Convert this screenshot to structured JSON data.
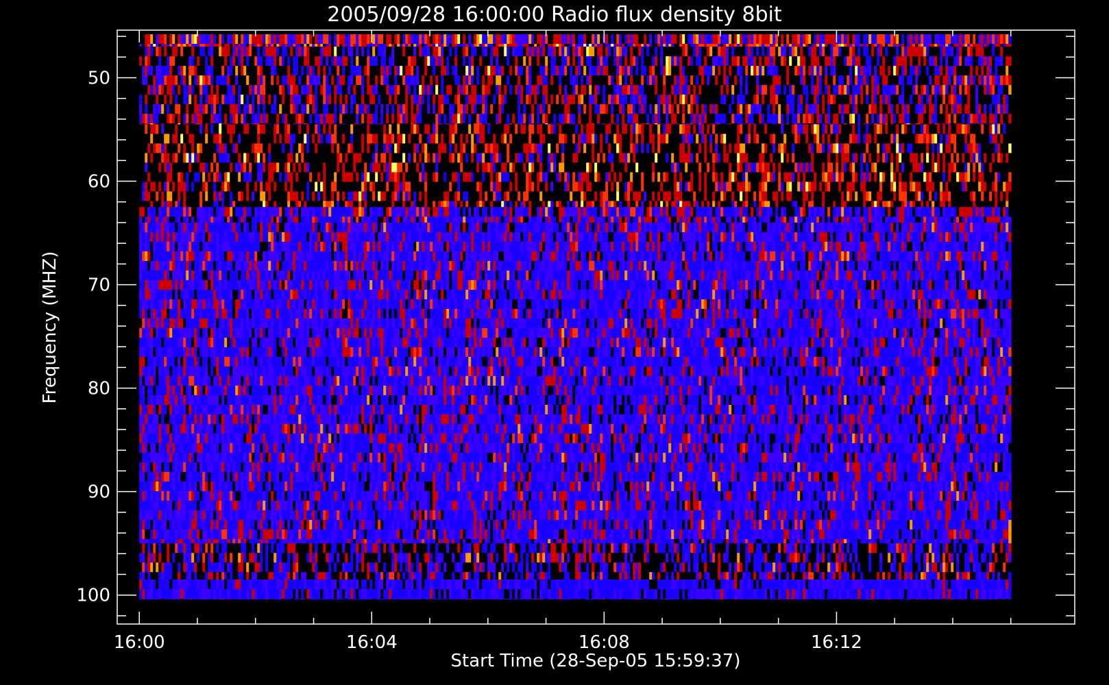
{
  "chart_data": {
    "type": "heatmap",
    "title": "2005/09/28 16:00:00 Radio flux density 8bit",
    "xlabel": "Start Time (28-Sep-05 15:59:37)",
    "ylabel": "Frequency (MHZ)",
    "x_tick_labels": [
      "16:00",
      "16:04",
      "16:08",
      "16:12"
    ],
    "x_ticks_minutes": [
      0,
      4,
      8,
      12
    ],
    "x_range_minutes": [
      -0.38,
      16.1
    ],
    "x_data_range_minutes": [
      0,
      15.0
    ],
    "y_tick_labels": [
      "50",
      "60",
      "70",
      "80",
      "90",
      "100"
    ],
    "y_ticks": [
      50,
      60,
      70,
      80,
      90,
      100
    ],
    "ylim": [
      45.4,
      102.8
    ],
    "y_data_range": [
      45.8,
      100.4
    ],
    "y_inverted": true,
    "colormap": [
      "#000000",
      "#1a00ff",
      "#3b00ff",
      "#cc0000",
      "#ff3300",
      "#ff9900",
      "#ffff66"
    ],
    "bands": [
      {
        "from": 45.8,
        "to": 47.0,
        "level": "mixed-hot"
      },
      {
        "from": 47.0,
        "to": 54.5,
        "level": "dark-red-stripes"
      },
      {
        "from": 54.5,
        "to": 62.5,
        "level": "black-red-yellow-stripes"
      },
      {
        "from": 62.5,
        "to": 64.0,
        "level": "blue-red"
      },
      {
        "from": 64.0,
        "to": 95.0,
        "level": "blue-purple-noise"
      },
      {
        "from": 95.0,
        "to": 98.5,
        "level": "dark-with-red-late"
      },
      {
        "from": 98.5,
        "to": 100.4,
        "level": "blue"
      }
    ],
    "grid": false
  }
}
